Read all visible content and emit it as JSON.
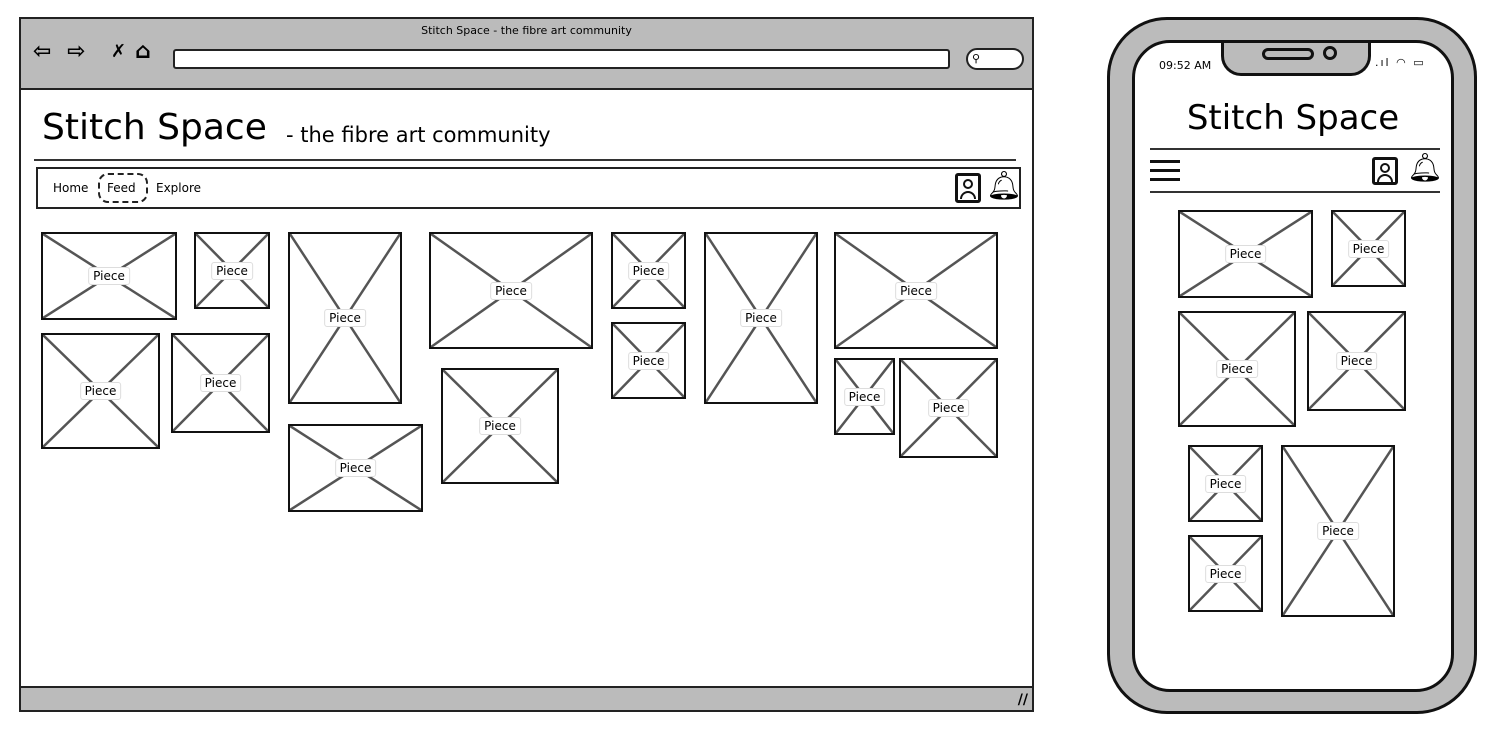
{
  "browser": {
    "window_title": "Stitch Space - the fibre art community",
    "url_value": "",
    "icons": [
      "back-arrow-icon",
      "forward-arrow-icon",
      "stop-icon",
      "home-icon",
      "search-icon"
    ]
  },
  "desktop": {
    "title": "Stitch Space",
    "subtitle": "- the fibre art community",
    "nav": [
      {
        "label": "Home"
      },
      {
        "label": "Feed",
        "selected": true
      },
      {
        "label": "Explore"
      }
    ],
    "icons": [
      "profile-icon",
      "bell-icon"
    ],
    "tiles": [
      {
        "label": "Piece"
      },
      {
        "label": "Piece"
      },
      {
        "label": "Piece"
      },
      {
        "label": "Piece"
      },
      {
        "label": "Piece"
      },
      {
        "label": "Piece"
      },
      {
        "label": "Piece"
      },
      {
        "label": "Piece"
      },
      {
        "label": "Piece"
      },
      {
        "label": "Piece"
      },
      {
        "label": "Piece"
      },
      {
        "label": "Piece"
      },
      {
        "label": "Piece"
      },
      {
        "label": "Piece"
      }
    ]
  },
  "mobile": {
    "time": "09:52 AM",
    "title": "Stitch Space",
    "icons": [
      "menu-icon",
      "profile-icon",
      "bell-icon",
      "signal-icon",
      "wifi-icon",
      "battery-icon"
    ],
    "tiles": [
      {
        "label": "Piece"
      },
      {
        "label": "Piece"
      },
      {
        "label": "Piece"
      },
      {
        "label": "Piece"
      },
      {
        "label": "Piece"
      },
      {
        "label": "Piece"
      },
      {
        "label": "Piece"
      }
    ]
  }
}
